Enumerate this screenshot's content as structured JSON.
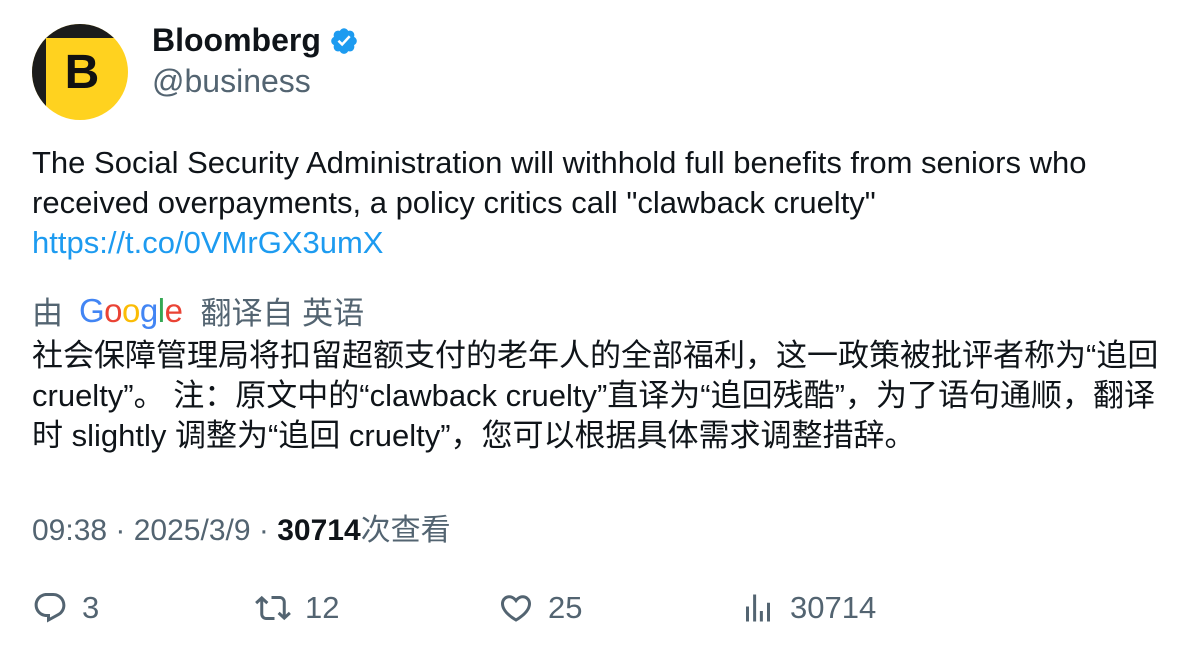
{
  "author": {
    "display_name": "Bloomberg",
    "handle": "@business",
    "avatar_letter": "B",
    "verified": true,
    "verified_icon": "verified-badge-icon",
    "brand_color": "#ffd21f"
  },
  "tweet": {
    "text": "The Social Security Administration will withhold full benefits from seniors who received overpayments, a policy critics call \"clawback cruelty\"",
    "link": "https://t.co/0VMrGX3umX"
  },
  "translation": {
    "prefix": "由",
    "provider_letters": [
      "G",
      "o",
      "o",
      "g",
      "l",
      "e"
    ],
    "suffix": "翻译自 英语",
    "text": "社会保障管理局将扣留超额支付的老年人的全部福利，这一政策被批评者称为“追回 cruelty”。 注：原文中的“clawback cruelty”直译为“追回残酷”，为了语句通顺，翻译时 slightly 调整为“追回 cruelty”，您可以根据具体需求调整措辞。"
  },
  "meta": {
    "time": "09:38",
    "separator": " · ",
    "date": "2025/3/9",
    "views_count": "30714",
    "views_label": "次查看"
  },
  "actions": {
    "replies": "3",
    "retweets": "12",
    "likes": "25",
    "views": "30714"
  },
  "colors": {
    "link": "#1d9bf0",
    "secondary_text": "#536471",
    "primary_text": "#0f1419"
  }
}
